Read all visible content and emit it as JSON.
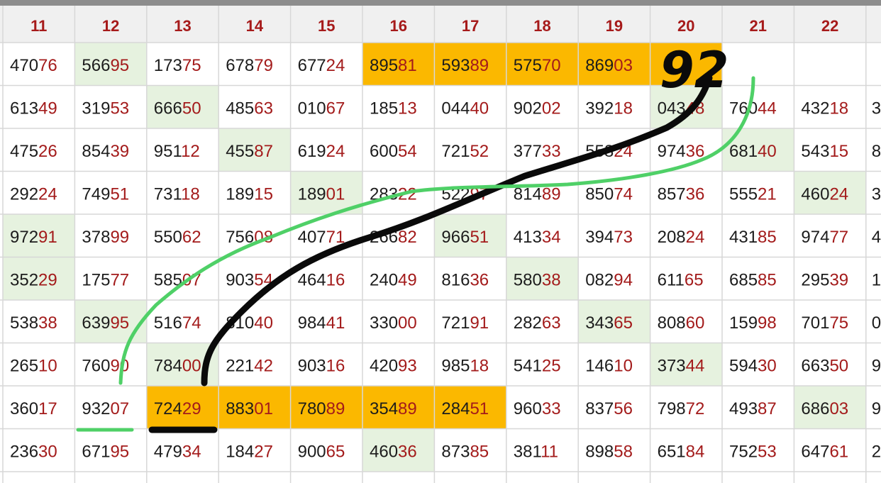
{
  "table": {
    "headers": [
      "11",
      "12",
      "13",
      "14",
      "15",
      "16",
      "17",
      "18",
      "19",
      "20",
      "21",
      "22"
    ],
    "rows": [
      [
        "47076",
        "56695",
        "17375",
        "67879",
        "67724",
        "89581",
        "59389",
        "57570",
        "86903",
        "",
        "",
        ""
      ],
      [
        "61349",
        "31953",
        "66650",
        "48563",
        "01067",
        "18513",
        "04440",
        "90202",
        "39218",
        "04348",
        "76044",
        "43218"
      ],
      [
        "47526",
        "85439",
        "95112",
        "45587",
        "61924",
        "60054",
        "72152",
        "37733",
        "55824",
        "97436",
        "68140",
        "54315"
      ],
      [
        "29224",
        "74951",
        "73118",
        "18915",
        "18901",
        "28322",
        "52297",
        "81489",
        "85074",
        "85736",
        "55521",
        "46024"
      ],
      [
        "97291",
        "37899",
        "55062",
        "75608",
        "40771",
        "26682",
        "96651",
        "41334",
        "39473",
        "20824",
        "43185",
        "97477"
      ],
      [
        "35229",
        "17577",
        "58507",
        "90354",
        "46416",
        "24049",
        "81636",
        "58038",
        "08294",
        "61165",
        "68585",
        "29539"
      ],
      [
        "53838",
        "63995",
        "51674",
        "81040",
        "98441",
        "33000",
        "72191",
        "28263",
        "34365",
        "80860",
        "15998",
        "70175"
      ],
      [
        "26510",
        "76090",
        "78400",
        "22142",
        "90316",
        "42093",
        "98518",
        "54125",
        "14610",
        "37344",
        "59430",
        "66350"
      ],
      [
        "36017",
        "93207",
        "72429",
        "88301",
        "78089",
        "35489",
        "28451",
        "96033",
        "83756",
        "79872",
        "49387",
        "68603"
      ],
      [
        "23630",
        "67195",
        "47934",
        "18427",
        "90065",
        "46036",
        "87385",
        "38111",
        "89858",
        "65184",
        "75253",
        "64761"
      ]
    ],
    "overflow_edge": [
      "",
      "",
      "3",
      "8",
      "3",
      "4",
      "1",
      "0",
      "9",
      "9",
      "2",
      ""
    ],
    "cell_fill": [
      [
        "",
        "g",
        "",
        "",
        "",
        "o",
        "o",
        "o",
        "o",
        "o",
        "w",
        ""
      ],
      [
        "",
        "",
        "g",
        "",
        "",
        "",
        "",
        "",
        "",
        "g",
        "",
        ""
      ],
      [
        "",
        "",
        "",
        "g",
        "",
        "",
        "",
        "",
        "",
        "",
        "g",
        ""
      ],
      [
        "",
        "",
        "",
        "",
        "g",
        "",
        "",
        "",
        "",
        "",
        "",
        "g"
      ],
      [
        "g",
        "",
        "",
        "",
        "",
        "",
        "g",
        "",
        "",
        "",
        "",
        ""
      ],
      [
        "g",
        "",
        "",
        "",
        "",
        "",
        "",
        "g",
        "",
        "",
        "",
        ""
      ],
      [
        "",
        "g",
        "",
        "",
        "",
        "",
        "",
        "",
        "g",
        "",
        "",
        ""
      ],
      [
        "",
        "",
        "g",
        "",
        "",
        "",
        "",
        "",
        "",
        "g",
        "",
        ""
      ],
      [
        "",
        "",
        "o",
        "o",
        "o",
        "o",
        "o",
        "",
        "",
        "",
        "",
        "g"
      ],
      [
        "",
        "",
        "",
        "",
        "",
        "g",
        "",
        "",
        "",
        "",
        "",
        ""
      ]
    ],
    "colors": {
      "header_bg": "#f0f0f0",
      "header_text": "#a61a1a",
      "grid_line": "#d7d7d7",
      "highlight_orange": "#fbb800",
      "highlight_green": "#e6f2df",
      "digit_main": "#1c1c1c",
      "digit_tail": "#a31b1b"
    }
  },
  "annotation": {
    "handwritten_text": "92",
    "stroke_colors": {
      "black": "#0a0a0a",
      "green": "#4fd067"
    }
  }
}
